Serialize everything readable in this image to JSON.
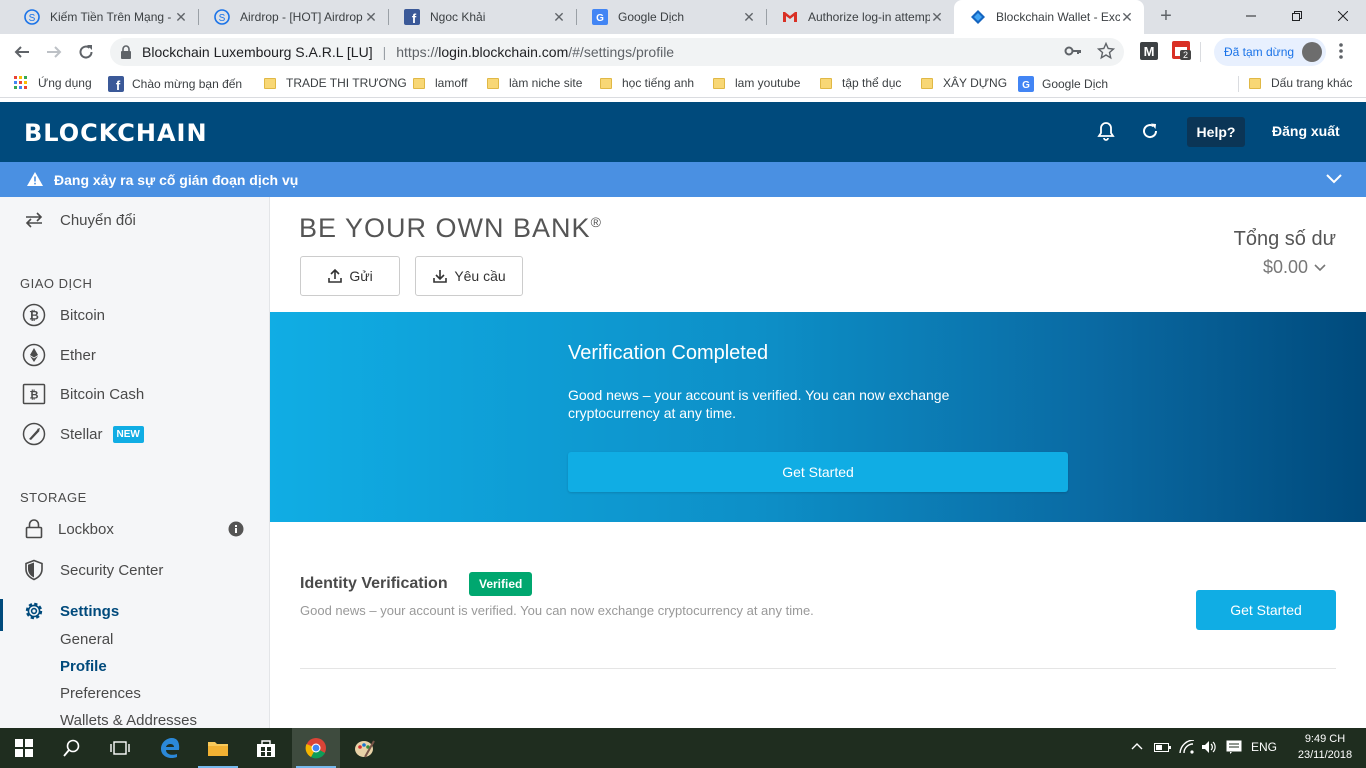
{
  "browser": {
    "tabs": [
      {
        "title": "Kiếm Tiền Trên Mạng - ",
        "icon": "s-circle-icon"
      },
      {
        "title": "Airdrop - [HOT] Airdrop",
        "icon": "s-circle-icon"
      },
      {
        "title": "Ngoc Khải",
        "icon": "facebook-icon"
      },
      {
        "title": "Google Dịch",
        "icon": "google-translate-icon"
      },
      {
        "title": "Authorize log-in attemp",
        "icon": "gmail-icon"
      },
      {
        "title": "Blockchain Wallet - Exc",
        "icon": "blockchain-icon"
      }
    ],
    "address": {
      "site": "Blockchain Luxembourg S.A.R.L [LU]",
      "url_prefix": "https://",
      "url_host": "login.blockchain.com",
      "url_path": "/#/settings/profile"
    },
    "profile_label": "Đã tạm dừng",
    "ext_badge": "2",
    "bookmarks": [
      {
        "label": "Ứng dụng",
        "icon": "apps-grid-icon"
      },
      {
        "label": "Chào mừng bạn đến",
        "icon": "facebook-icon"
      },
      {
        "label": "TRADE THI TRƯƠNG",
        "icon": "folder-icon"
      },
      {
        "label": "lamoff",
        "icon": "folder-icon"
      },
      {
        "label": "làm niche site",
        "icon": "folder-icon"
      },
      {
        "label": "học tiếng anh",
        "icon": "folder-icon"
      },
      {
        "label": "lam youtube",
        "icon": "folder-icon"
      },
      {
        "label": "tập thể dục",
        "icon": "folder-icon"
      },
      {
        "label": "XÂY DỰNG",
        "icon": "folder-icon"
      },
      {
        "label": "Google Dịch",
        "icon": "google-translate-icon"
      },
      {
        "label": "Dấu trang khác",
        "icon": "folder-icon"
      }
    ]
  },
  "header": {
    "logo": "BLOCKCHAIN",
    "help": "Help?",
    "logout": "Đăng xuất"
  },
  "alert": {
    "text": "Đang xảy ra sự cố gián đoạn dịch vụ"
  },
  "sidebar": {
    "top_item": "Chuyển đổi",
    "trade_heading": "GIAO DỊCH",
    "wallets": [
      {
        "label": "Bitcoin",
        "icon": "bitcoin-icon"
      },
      {
        "label": "Ether",
        "icon": "ether-icon"
      },
      {
        "label": "Bitcoin Cash",
        "icon": "bitcoin-cash-icon"
      },
      {
        "label": "Stellar",
        "icon": "stellar-icon",
        "badge": "NEW"
      }
    ],
    "storage_heading": "STORAGE",
    "lockbox": "Lockbox",
    "security": "Security Center",
    "settings": "Settings",
    "settings_sub": [
      "General",
      "Profile",
      "Preferences",
      "Wallets & Addresses"
    ],
    "active_sub": "Profile",
    "accent": "#004a7c"
  },
  "main": {
    "tagline": "BE YOUR OWN BANK",
    "tagline_mark": "®",
    "send": "Gửi",
    "request": "Yêu cầu",
    "balance_label": "Tổng số dư",
    "balance_value": "$0.00"
  },
  "banner": {
    "title": "Verification Completed",
    "text": "Good news – your account is verified. You can now exchange cryptocurrency at any time.",
    "button": "Get Started"
  },
  "identity": {
    "title": "Identity Verification",
    "badge": "Verified",
    "text": "Good news – your account is verified. You can now exchange cryptocurrency at any time.",
    "button": "Get Started",
    "badge_color": "#00a76f"
  },
  "taskbar": {
    "language": "ENG",
    "time": "9:49 CH",
    "date": "23/11/2018"
  },
  "colors": {
    "brand": "#004a7c",
    "accent": "#10ade4",
    "alert": "#4a90e2"
  }
}
